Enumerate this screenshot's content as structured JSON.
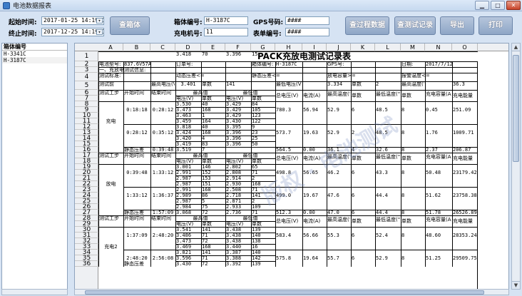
{
  "window": {
    "title": "电池数据报表"
  },
  "toolbar": {
    "start_label": "起始时间:",
    "start_value": "2017-01-25 14:19:15",
    "end_label": "终止时间:",
    "end_value": "2017-12-25 14:19:15",
    "query_box_button": "查箱体",
    "box_no_label": "箱体编号:",
    "box_no_value": "H-3187C",
    "gps_label": "GPS号码:",
    "gps_value": "####",
    "charger_label": "充电机号:",
    "charger_value": "11",
    "meter_label": "表单编号:",
    "meter_value": "####",
    "process_button": "查过程数据",
    "test_button": "查测试记录",
    "export_button": "导出",
    "print_button": "打印"
  },
  "left_panel": {
    "header": "箱体编号",
    "items": [
      "H-3341C",
      "H-3187C"
    ]
  },
  "sheet": {
    "columns": [
      "A",
      "B",
      "C",
      "D",
      "E",
      "F",
      "G",
      "H",
      "I",
      "J",
      "K",
      "L",
      "M",
      "N",
      "O"
    ],
    "rows": [
      "1",
      "2",
      "3",
      "4",
      "5",
      "6",
      "7",
      "8",
      "9",
      "10",
      "11",
      "12",
      "13",
      "14",
      "15",
      "16",
      "17",
      "18",
      "19",
      "20",
      "21",
      "22",
      "23",
      "24",
      "25",
      "26",
      "27",
      "28",
      "29",
      "30",
      "31",
      "32",
      "33",
      "34",
      "35",
      "36"
    ],
    "title": "PACK充放电测试记录表",
    "info": {
      "model_label": "电池型号:",
      "model_value": "837.6V57A",
      "order_label": "订单号:",
      "box_label": "箱体编号:",
      "box_value": "H-3187C",
      "gps_label": "GPS号:",
      "date_label": "日期:",
      "date_value": "2017/7/12",
      "section": "一、充放电测试信息:",
      "std_label": "测试标准:",
      "static_label": "动态压差<=",
      "still_label": "静态压差<=",
      "cap_label": "放电容量>=",
      "alarm_label": "报警温度<=",
      "pre_label": "测试前",
      "max_v_label": "最高电压(V)",
      "max_v_val": "3.401",
      "cell_label": "单数",
      "cell_val": "141",
      "low_v_label": "最低电压(V)",
      "low_v_val": "3.334",
      "cell_val2": "2",
      "max_t_label": "最高温度(℃)",
      "max_t_val": "36.3"
    },
    "headers": {
      "step": "测试工步",
      "start": "开始时间",
      "end": "结束时间",
      "max": "最高值",
      "min": "最低值",
      "voltage": "电压(V)",
      "count": "单数",
      "total_v": "总电压(V)",
      "current": "电流(A)",
      "max_temp": "最高温度(℃)",
      "count2": "单数",
      "min_temp": "最低温度(℃)",
      "charge_cap": "充电容量(AH)",
      "charge_energy": "充电能量"
    },
    "charge": {
      "label": "充电",
      "blocks": [
        {
          "start": "0:18:18",
          "end": "0:28:12",
          "max": [
            [
              "3.530",
              "40"
            ],
            [
              "3.473",
              "168"
            ],
            [
              "3.463",
              "1"
            ],
            [
              "3.459",
              "164"
            ]
          ],
          "min": [
            [
              "3.429",
              "84"
            ],
            [
              "3.429",
              "105"
            ],
            [
              "3.429",
              "123"
            ],
            [
              "3.430",
              "122"
            ]
          ],
          "total_v": "780.3",
          "current": "56.94",
          "max_t": "52.9",
          "c": "6",
          "min_t": "48.5",
          "c2": "8",
          "cap": "0.45",
          "energy": "251.09"
        },
        {
          "start": "0:28:12",
          "end": "0:35:12",
          "max": [
            [
              "3.818",
              "40"
            ],
            [
              "3.424",
              "168"
            ],
            [
              "3.420",
              "4"
            ],
            [
              "3.419",
              "83"
            ]
          ],
          "min": [
            [
              "3.395",
              "9"
            ],
            [
              "3.396",
              "23"
            ],
            [
              "3.396",
              "25"
            ],
            [
              "3.396",
              "50"
            ]
          ],
          "total_v": "573.7",
          "current": "19.63",
          "max_t": "52.9",
          "c": "2",
          "min_t": "48.5",
          "c2": "8",
          "cap": "1.76",
          "energy": "1009.71"
        }
      ],
      "rest_label": "静态压差",
      "rest_end": "0:39:48",
      "rest_row": [
        "3.519",
        "7",
        "",
        "",
        "564.5",
        "0.00",
        "36.1",
        "4",
        "32.6",
        "8",
        "2.37",
        "206.87"
      ]
    },
    "discharge": {
      "label": "放电",
      "blocks": [
        {
          "start": "0:39:48",
          "end": "1:33:12",
          "max": [
            [
              "3.001",
              "146"
            ],
            [
              "2.991",
              "152"
            ],
            [
              "2.987",
              "153"
            ],
            [
              "2.987",
              "151"
            ]
          ],
          "min": [
            [
              "2.802",
              "65"
            ],
            [
              "2.808",
              "71"
            ],
            [
              "2.914",
              "2"
            ],
            [
              "2.930",
              "168"
            ]
          ],
          "total_v": "498.8",
          "current": "56.65",
          "max_t": "46.2",
          "c": "6",
          "min_t": "43.3",
          "c2": "8",
          "cap": "50.48",
          "energy": "23179.42"
        },
        {
          "start": "1:33:12",
          "end": "1:36:37",
          "max": [
            [
              "2.991",
              "168"
            ],
            [
              "2.989",
              "86"
            ],
            [
              "2.987",
              "5"
            ],
            [
              "2.984",
              "75"
            ]
          ],
          "min": [
            [
              "2.508",
              "71"
            ],
            [
              "2.718",
              "141"
            ],
            [
              "2.871",
              "2"
            ],
            [
              "2.933",
              "109"
            ]
          ],
          "total_v": "499.0",
          "current": "19.67",
          "max_t": "47.6",
          "c": "6",
          "min_t": "44.4",
          "c2": "8",
          "cap": "51.62",
          "energy": "23758.38"
        }
      ],
      "rest_label": "静态压差",
      "rest_end": "1:57:09",
      "rest_row": [
        "3.068",
        "72",
        "2.736",
        "71",
        "512.3",
        "0.00",
        "47.0",
        "6",
        "44.4",
        "8",
        "51.78",
        "26526.89"
      ]
    },
    "charge2": {
      "label": "充电2",
      "blocks": [
        {
          "start": "1:37:09",
          "end": "2:48:20",
          "max": [
            [
              "3.541",
              "141"
            ],
            [
              "3.486",
              "71"
            ],
            [
              "3.473",
              "72"
            ],
            [
              "3.469",
              "168"
            ]
          ],
          "min": [
            [
              "3.438",
              "139"
            ],
            [
              "3.438",
              "140"
            ],
            [
              "3.438",
              "138"
            ],
            [
              "3.440",
              "16"
            ]
          ],
          "total_v": "583.4",
          "current": "56.66",
          "max_t": "55.3",
          "c": "6",
          "min_t": "52.4",
          "c2": "8",
          "cap": "48.60",
          "energy": "28353.24"
        },
        {
          "start": "2:48:20",
          "end": "2:56:08",
          "max": [
            [
              "3.821",
              "141"
            ],
            [
              "3.596",
              "71"
            ],
            [
              "3.430",
              "72"
            ],
            [
              "3.418",
              "70"
            ]
          ],
          "min": [
            [
              "3.387",
              "140"
            ],
            [
              "3.388",
              "142"
            ],
            [
              "3.392",
              "139"
            ],
            [
              "3.396",
              "15"
            ]
          ],
          "total_v": "575.8",
          "current": "19.64",
          "max_t": "55.7",
          "c": "6",
          "min_t": "52.9",
          "c2": "8",
          "cap": "51.25",
          "energy": "29509.75"
        }
      ],
      "rest_label": "静态压差"
    }
  }
}
